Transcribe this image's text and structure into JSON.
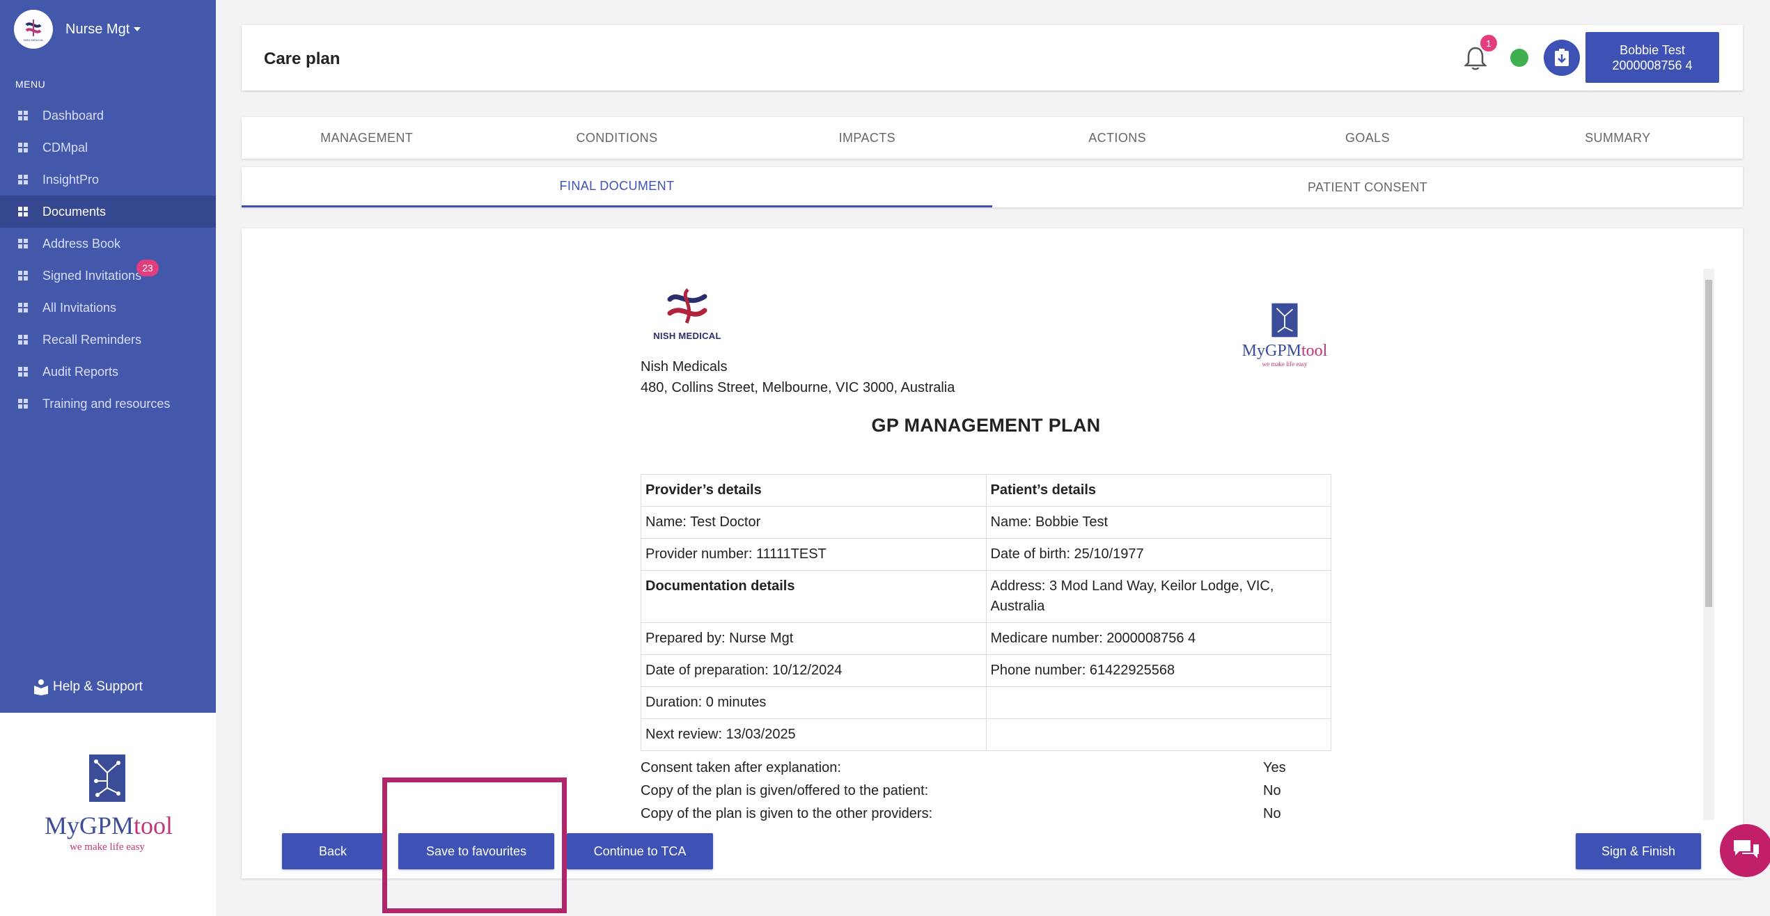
{
  "sidebar": {
    "user_name": "Nurse Mgt",
    "menu_label": "MENU",
    "items": [
      {
        "label": "Dashboard"
      },
      {
        "label": "CDMpal"
      },
      {
        "label": "InsightPro"
      },
      {
        "label": "Documents"
      },
      {
        "label": "Address Book"
      },
      {
        "label": "Signed Invitations",
        "badge": "23"
      },
      {
        "label": "All Invitations"
      },
      {
        "label": "Recall Reminders"
      },
      {
        "label": "Audit Reports"
      },
      {
        "label": "Training and resources"
      }
    ],
    "active_item": "Documents",
    "help_label": "Help & Support",
    "brand_logo_text": "NISH MEDICAL"
  },
  "logo": {
    "my": "My",
    "gpm": "GPM",
    "tool": "tool",
    "tagline": "we make life easy"
  },
  "header": {
    "title": "Care plan",
    "notification_count": "1",
    "status_color": "#3fb04f",
    "patient_name": "Bobbie Test",
    "patient_medicare": "2000008756 4"
  },
  "tabs": [
    "MANAGEMENT",
    "CONDITIONS",
    "IMPACTS",
    "ACTIONS",
    "GOALS",
    "SUMMARY"
  ],
  "subtabs": {
    "active": "FINAL DOCUMENT",
    "other": "PATIENT CONSENT"
  },
  "document": {
    "nish_logo_text": "NISH MEDICAL",
    "mygp_logo": {
      "my": "My",
      "gpm": "GPM",
      "tool": "tool",
      "tagline": "we make life easy"
    },
    "practice_name": "Nish Medicals",
    "practice_address": "480, Collins Street, Melbourne, VIC 3000, Australia",
    "plan_title": "GP MANAGEMENT PLAN",
    "table": {
      "provider_header": "Provider’s details",
      "patient_header": "Patient’s details",
      "provider_name": "Name: Test Doctor",
      "patient_name": "Name: Bobbie Test",
      "provider_number": "Provider number: 11111TEST",
      "dob": "Date of birth: 25/10/1977",
      "documentation_header": "Documentation details",
      "address": "Address: 3 Mod Land Way, Keilor Lodge, VIC, Australia",
      "prepared_by": "Prepared by: Nurse Mgt",
      "medicare": "Medicare number: 2000008756 4",
      "date_prep": "Date of preparation: 10/12/2024",
      "phone": "Phone number: 61422925568",
      "duration": "Duration:  0 minutes",
      "next_review": "Next review:  13/03/2025"
    },
    "consent": [
      {
        "label": "Consent taken after explanation:",
        "value": "Yes"
      },
      {
        "label": "Copy of the plan is given/offered to the patient:",
        "value": "No"
      },
      {
        "label": "Copy of the plan is given to the other providers:",
        "value": "No"
      }
    ]
  },
  "buttons": {
    "back": "Back",
    "save_fav": "Save to favourites",
    "continue_tca": "Continue to TCA",
    "sign_finish": "Sign & Finish"
  },
  "colors": {
    "primary": "#3e51b5",
    "sidebar": "#4358aa",
    "badge": "#e23e7e",
    "highlight": "#b0266a"
  }
}
